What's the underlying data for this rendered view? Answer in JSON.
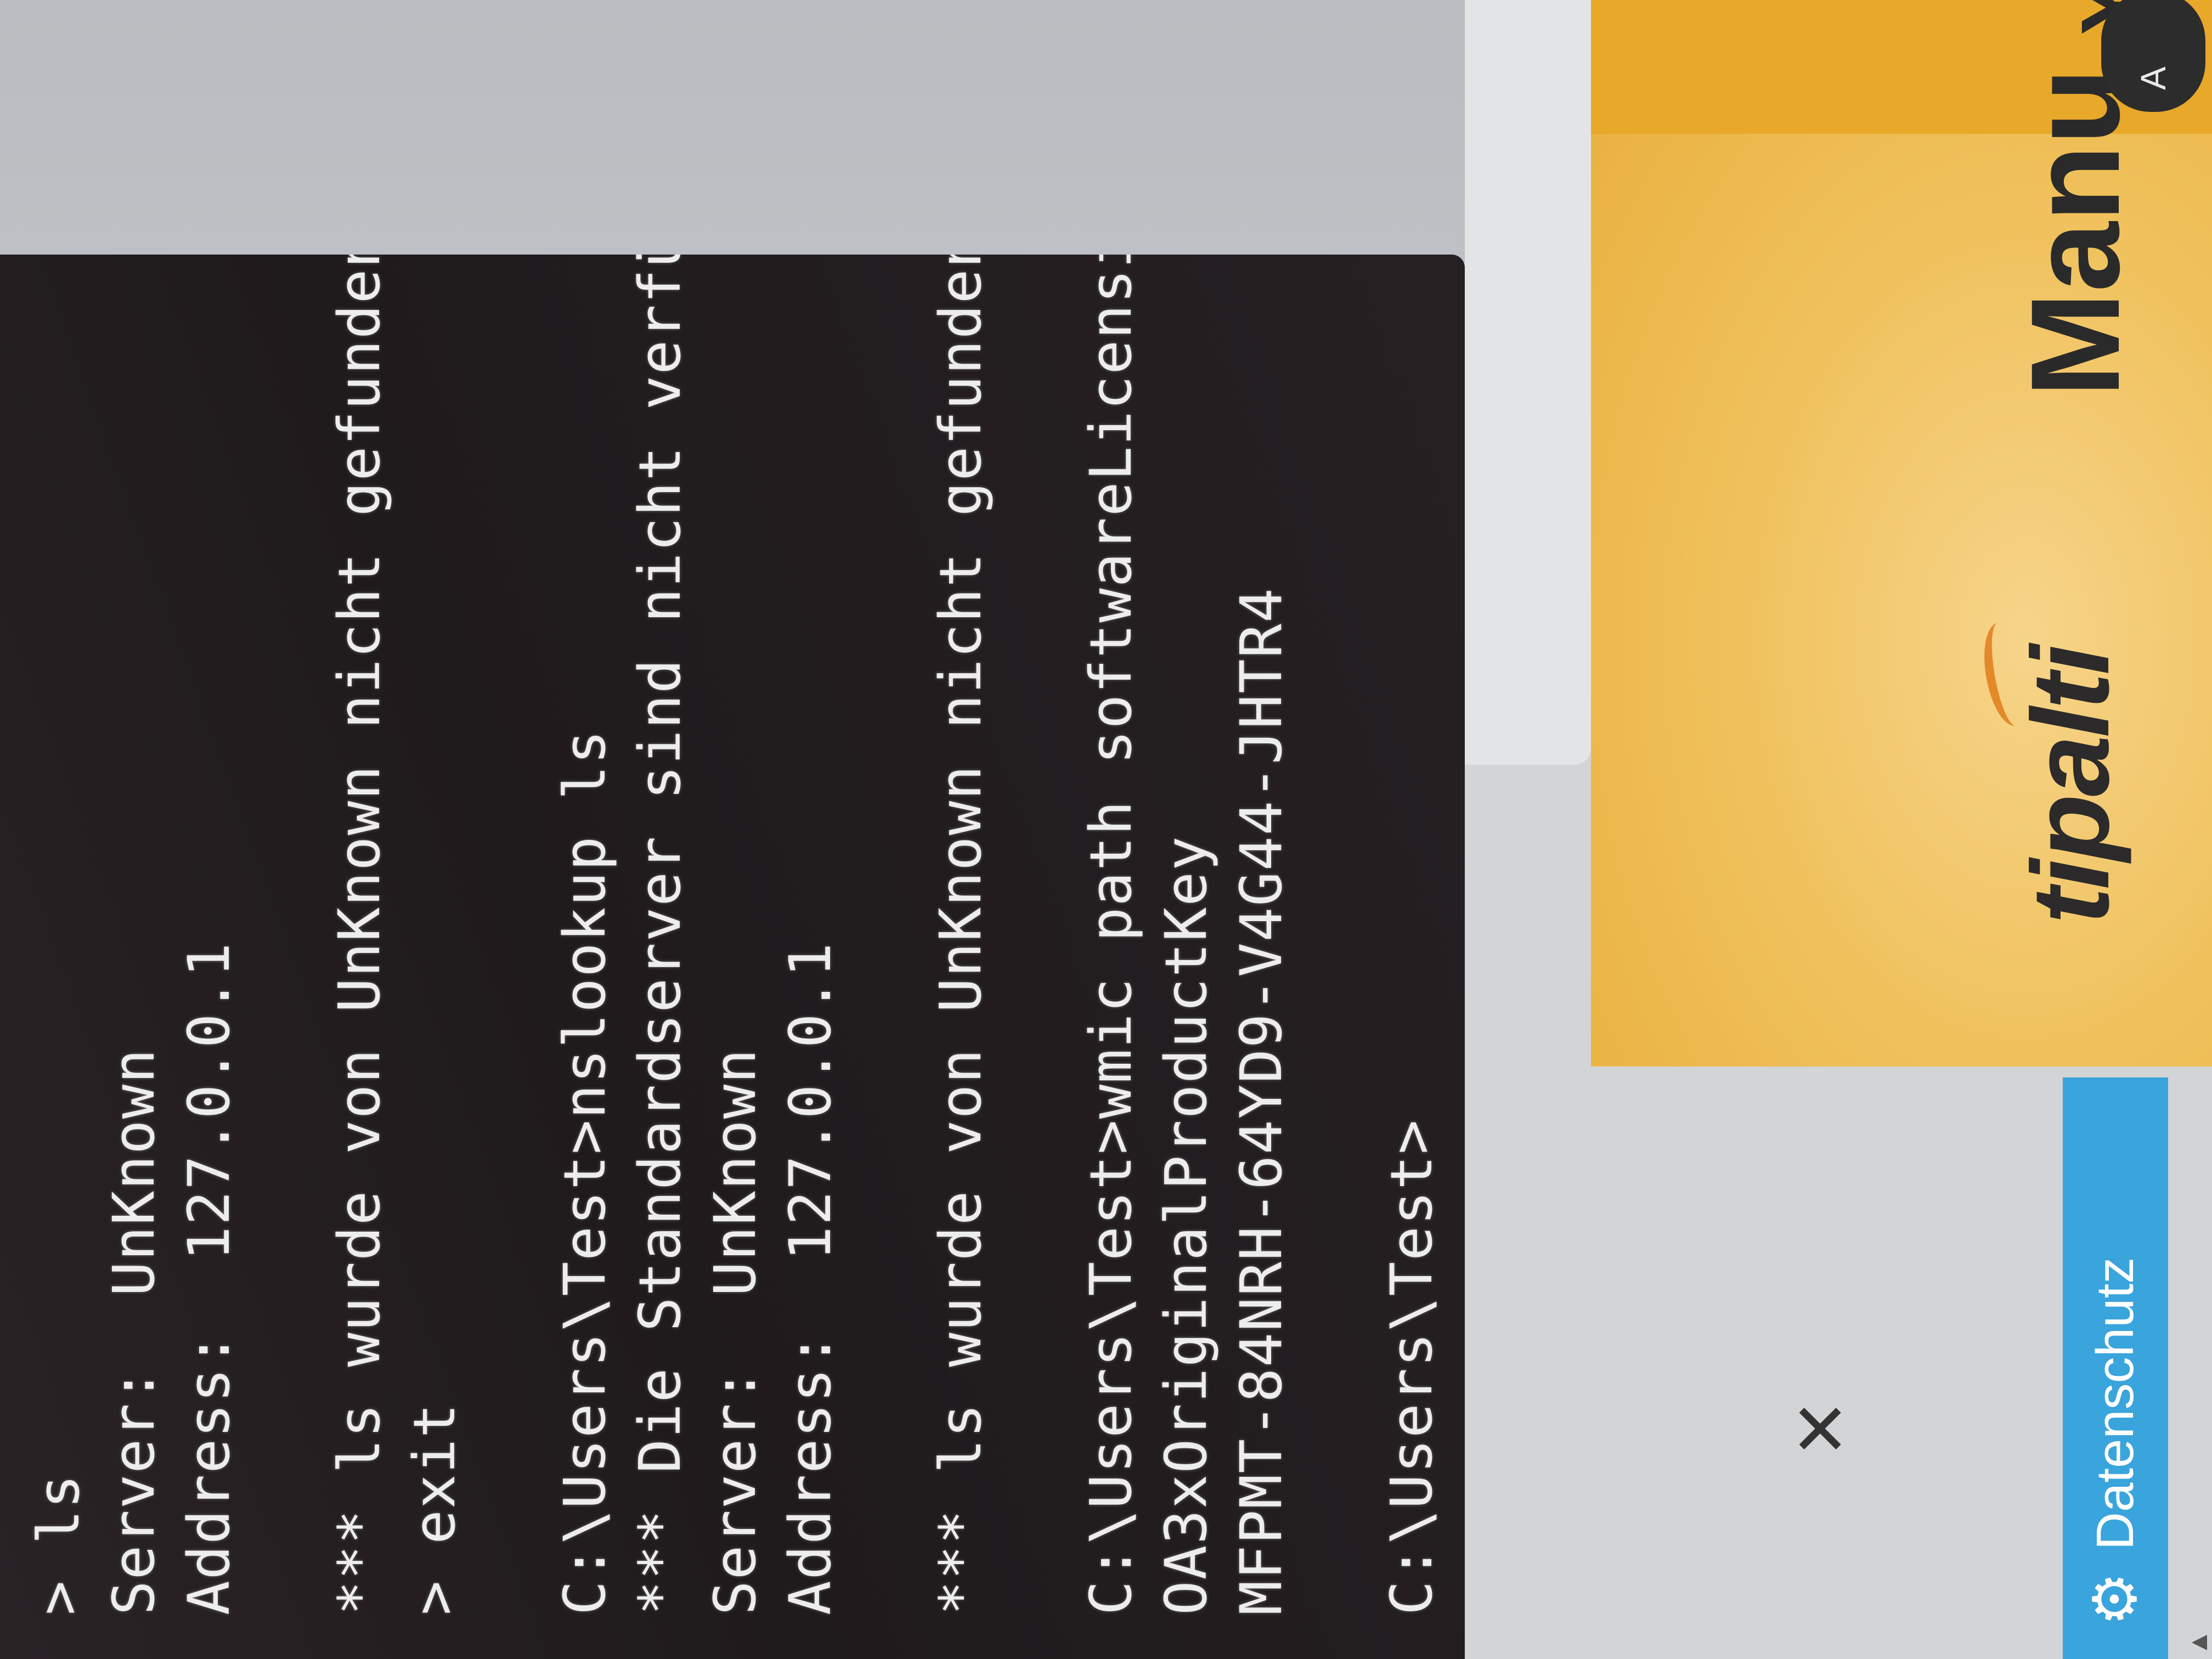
{
  "terminal": {
    "lines": [
      "> ls",
      "Server:  UnKnown",
      "Address:  127.0.0.1",
      "",
      "*** ls wurde von UnKnown nicht gefunden: Non-existent domain",
      "> exit",
      "",
      "C:\\Users\\Test>nslookup ls",
      "*** Die Standardserver sind nicht verfügbar",
      "Server:  UnKnown",
      "Address:  127.0.0.1",
      "",
      "*** ls wurde von UnKnown nicht gefunden: Non-existent domain",
      "",
      "C:\\Users\\Test>wmic path softwareLicensingService get",
      "OA3xOriginalProductKey",
      "MFPMT-84NRH-64YD9-V4G44-JHTR4",
      "",
      "C:\\Users\\Test>"
    ]
  },
  "privacy": {
    "label": "Datenschutz",
    "icon": "gear-icon"
  },
  "close": {
    "glyph": "✕"
  },
  "ad": {
    "logo": "tipalti",
    "headline": "Manu",
    "corner_text": "Y",
    "pill_text": "A"
  },
  "scroll": {
    "glyph": "▲"
  },
  "colors": {
    "terminal_bg": "#221c1f",
    "terminal_text": "#ededed",
    "privacy_tab": "#3aa4dc",
    "ad_orange": "#f0c25e"
  }
}
